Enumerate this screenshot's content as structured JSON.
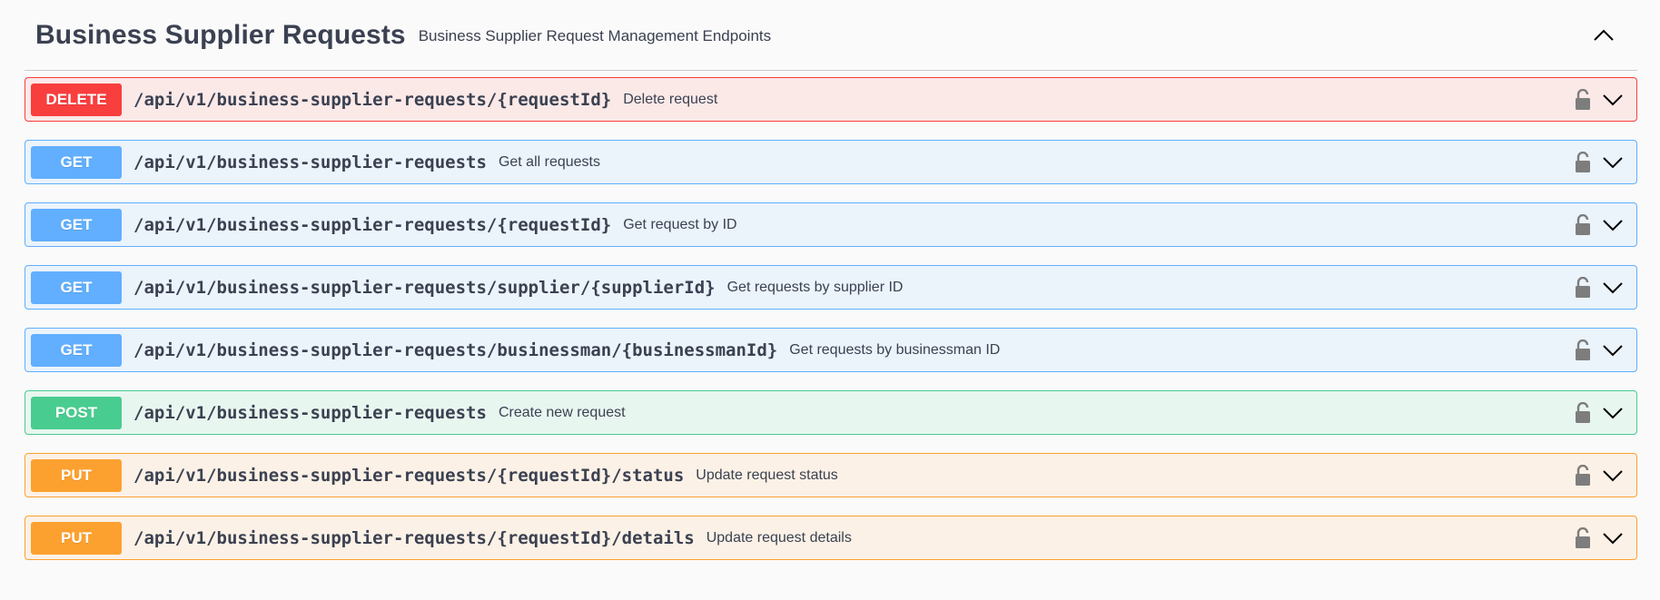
{
  "section": {
    "title": "Business Supplier Requests",
    "description": "Business Supplier Request Management Endpoints",
    "toggle_icon": "chevron-up-icon"
  },
  "operations": [
    {
      "method": "DELETE",
      "path": "/api/v1/business-supplier-requests/{requestId}",
      "summary": "Delete request"
    },
    {
      "method": "GET",
      "path": "/api/v1/business-supplier-requests",
      "summary": "Get all requests"
    },
    {
      "method": "GET",
      "path": "/api/v1/business-supplier-requests/{requestId}",
      "summary": "Get request by ID"
    },
    {
      "method": "GET",
      "path": "/api/v1/business-supplier-requests/supplier/{supplierId}",
      "summary": "Get requests by supplier ID"
    },
    {
      "method": "GET",
      "path": "/api/v1/business-supplier-requests/businessman/{businessmanId}",
      "summary": "Get requests by businessman ID"
    },
    {
      "method": "POST",
      "path": "/api/v1/business-supplier-requests",
      "summary": "Create new request"
    },
    {
      "method": "PUT",
      "path": "/api/v1/business-supplier-requests/{requestId}/status",
      "summary": "Update request status"
    },
    {
      "method": "PUT",
      "path": "/api/v1/business-supplier-requests/{requestId}/details",
      "summary": "Update request details"
    }
  ],
  "colors": {
    "delete": "#f93e3e",
    "get": "#61affe",
    "post": "#49cc90",
    "put": "#fca130",
    "text": "#3b4151"
  },
  "icons": {
    "lock": "lock-icon",
    "expand": "chevron-down-icon"
  }
}
